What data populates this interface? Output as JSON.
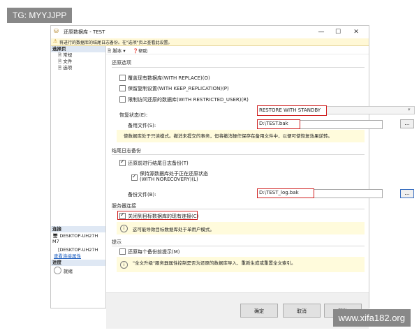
{
  "corner_tag": "TG: MYYJJPP",
  "watermark": "www.xifa182.org",
  "window": {
    "title": "还原数据库 - TEST",
    "minimize": "—",
    "maximize": "☐",
    "close": "✕",
    "warning": "将进行的数据库的结尾日志备份。在\"选项\"页上查看此设置。"
  },
  "left_pane": {
    "select_page_header": "选择页",
    "pages": [
      "常规",
      "文件",
      "选项"
    ],
    "connection_header": "连接",
    "server": "DESKTOP-UH27H M7",
    "server2": "[DESKTOP-UH27H",
    "view_connection_props": "查看连接属性",
    "progress_header": "进度",
    "progress_status": "就绪"
  },
  "toolbar": {
    "script": "脚本",
    "help": "帮助"
  },
  "restore_options": {
    "group_label": "还原选项",
    "overwrite": "覆盖现有数据库(WITH REPLACE)(O)",
    "keep_replication": "保留复制设置(WITH KEEP_REPLICATION)(P)",
    "restricted_user": "限制访问还原的数据库(WITH RESTRICTED_USER)(R)",
    "recovery_state_label": "恢复状态(E):",
    "recovery_state_value": "RESTORE WITH STANDBY",
    "standby_file_label": "备用文件(S):",
    "standby_file_value": "D:\\TEST.bak",
    "browse": "...",
    "recovery_info": "使数据库处于只读模式。撤消未提交的事务，但将撤消操作保存在备用文件中，以便可使恢复效果逆转。"
  },
  "tail_log": {
    "group_label": "结尾日志备份",
    "take_tail_log": "还原前进行结尾日志备份(T)",
    "leave_restoring": "保持源数据库处于正在还原状态",
    "leave_restoring_2": "(WITH NORECOVERY)(L)",
    "backup_file_label": "备份文件(B):",
    "backup_file_value": "D:\\TEST_log.bak",
    "browse": "..."
  },
  "server_connections": {
    "group_label": "服务器连接",
    "close_connections": "关闭到目标数据库的现有连接(C)",
    "info": "这可能导致目标数据库处于单用户模式。"
  },
  "prompt": {
    "group_label": "提示",
    "prompt_each": "还原每个备份前提示(M)",
    "info": "\"全文升级\"服务器属性控制是否为还原的数据库导入、重新生成或重置全文索引。"
  },
  "buttons": {
    "ok": "确定",
    "cancel": "取消",
    "help": "帮助"
  },
  "colors": {
    "highlight": "#d02020",
    "warning_bg": "#fff8d6",
    "info_bg": "#fffbdc"
  }
}
